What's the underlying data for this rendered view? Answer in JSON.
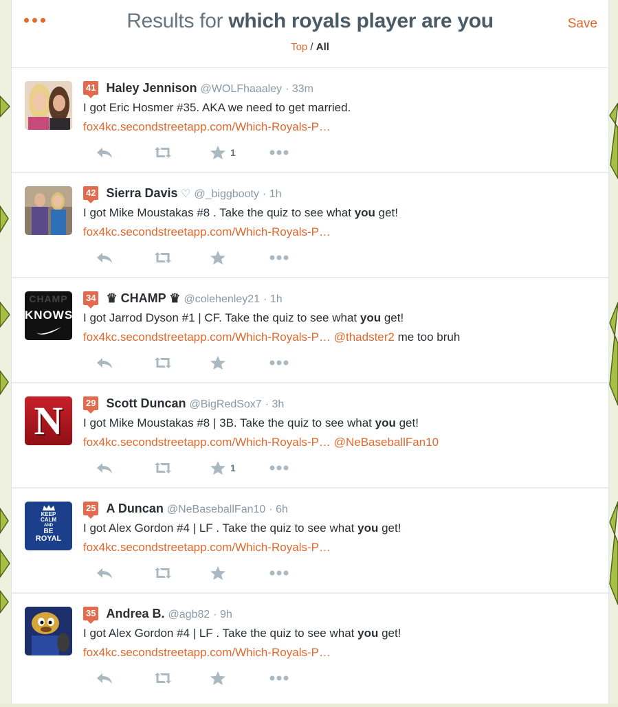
{
  "header": {
    "title_prefix": "Results for",
    "query": "which royals player are you",
    "save_label": "Save",
    "filter_top": "Top",
    "filter_sep": " / ",
    "filter_all": "All"
  },
  "colors": {
    "accent": "#e0682c",
    "badge": "#e36a4c",
    "muted": "#8899a6"
  },
  "tweets": [
    {
      "badge": "41",
      "name": "Haley Jennison",
      "handle": "@WOLFhaaaley",
      "time": "· 33m",
      "text": "I got Eric Hosmer #35. AKA we need to get married.",
      "link": "fox4kc.secondstreetapp.com/Which-Royals-P…",
      "favorites": "1"
    },
    {
      "badge": "42",
      "name": "Sierra Davis",
      "name_suffix": " ♡",
      "handle": "@_biggbooty",
      "time": "· 1h",
      "text_before": "I got Mike Moustakas #8 . Take the quiz to see what ",
      "text_bold": "you",
      "text_after": " get!",
      "link": "fox4kc.secondstreetapp.com/Which-Royals-P…"
    },
    {
      "badge": "34",
      "name": "♛ CHAMP ♛",
      "handle": "@colehenley21",
      "time": "· 1h",
      "text_before": "I got Jarrod Dyson #1 | CF. Take the quiz to see what ",
      "text_bold": "you",
      "text_after": " get!",
      "link": "fox4kc.secondstreetapp.com/Which-Royals-P…",
      "mention": "@thadster2",
      "after_mention": " me too bruh",
      "avatar_text_top": "CHAMP",
      "avatar_text_mid": "KNOWS"
    },
    {
      "badge": "29",
      "name": "Scott Duncan",
      "handle": "@BigRedSox7",
      "time": "· 3h",
      "text_before": "I got Mike Moustakas #8 | 3B. Take the quiz to see what ",
      "text_bold": "you",
      "text_after": " get!",
      "link": "fox4kc.secondstreetapp.com/Which-Royals-P…",
      "mention": "@NeBaseballFan10",
      "favorites": "1",
      "avatar_letter": "N"
    },
    {
      "badge": "25",
      "name": "A Duncan",
      "handle": "@NeBaseballFan10",
      "time": "· 6h",
      "text_before": "I got Alex Gordon #4 | LF . Take the quiz to see what ",
      "text_bold": "you",
      "text_after": " get!",
      "link": "fox4kc.secondstreetapp.com/Which-Royals-P…",
      "avatar_lines": [
        "KEEP",
        "CALM",
        "AND",
        "BE",
        "ROYAL"
      ]
    },
    {
      "badge": "35",
      "name": "Andrea B.",
      "handle": "@agb82",
      "time": "· 9h",
      "text_before": "I got Alex Gordon #4 | LF . Take the quiz to see what ",
      "text_bold": "you",
      "text_after": " get!",
      "link": "fox4kc.secondstreetapp.com/Which-Royals-P…"
    }
  ]
}
